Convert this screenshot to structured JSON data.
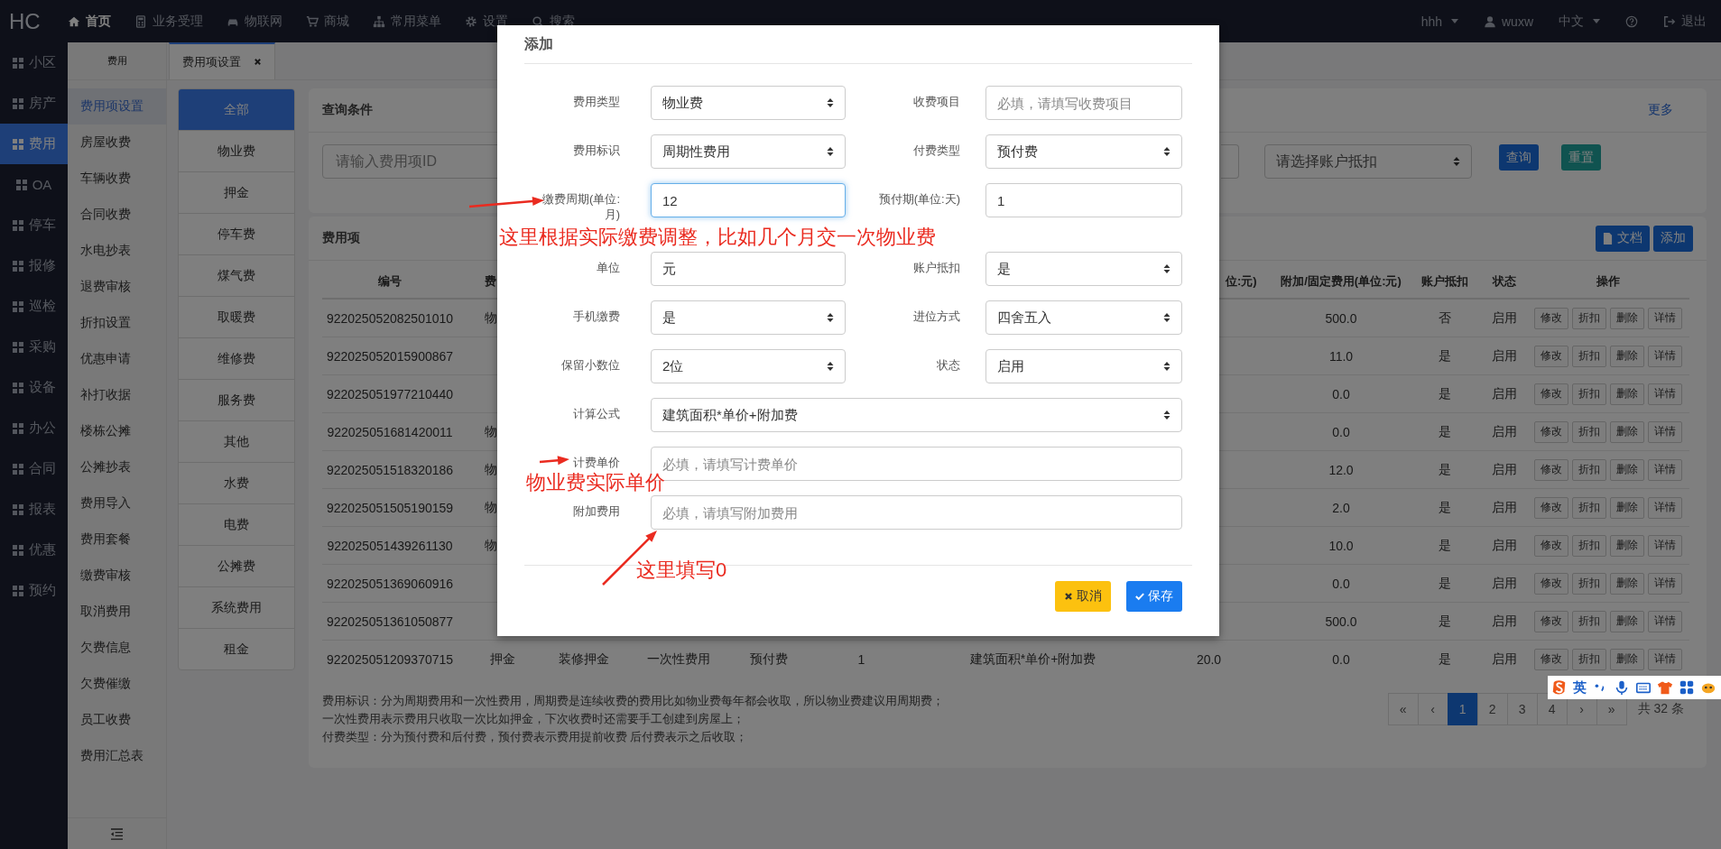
{
  "nav": {
    "logo": "HC",
    "items": [
      {
        "label": "首页",
        "selected": true
      },
      {
        "label": "业务受理",
        "selected": false
      },
      {
        "label": "物联网",
        "selected": false
      },
      {
        "label": "商城",
        "selected": false
      },
      {
        "label": "常用菜单",
        "selected": false
      },
      {
        "label": "设置",
        "selected": false
      },
      {
        "label": "搜索",
        "selected": false
      }
    ],
    "right": [
      {
        "kind": "menu",
        "label": "hhh"
      },
      {
        "kind": "user",
        "label": "wuxw"
      },
      {
        "kind": "menu",
        "label": "中文"
      },
      {
        "kind": "help"
      },
      {
        "kind": "logout",
        "label": "退出"
      }
    ]
  },
  "modules": [
    {
      "label": "小区",
      "selected": false
    },
    {
      "label": "房产",
      "selected": false
    },
    {
      "label": "费用",
      "selected": true
    },
    {
      "label": "OA",
      "selected": false
    },
    {
      "label": "停车",
      "selected": false
    },
    {
      "label": "报修",
      "selected": false
    },
    {
      "label": "巡检",
      "selected": false
    },
    {
      "label": "采购",
      "selected": false
    },
    {
      "label": "设备",
      "selected": false
    },
    {
      "label": "办公",
      "selected": false
    },
    {
      "label": "合同",
      "selected": false
    },
    {
      "label": "报表",
      "selected": false
    },
    {
      "label": "优惠",
      "selected": false
    },
    {
      "label": "预约",
      "selected": false
    }
  ],
  "submenu": {
    "title": "费用",
    "items": [
      {
        "label": "费用项设置",
        "selected": true
      },
      {
        "label": "房屋收费",
        "selected": false
      },
      {
        "label": "车辆收费",
        "selected": false
      },
      {
        "label": "合同收费",
        "selected": false
      },
      {
        "label": "水电抄表",
        "selected": false
      },
      {
        "label": "退费审核",
        "selected": false
      },
      {
        "label": "折扣设置",
        "selected": false
      },
      {
        "label": "优惠申请",
        "selected": false
      },
      {
        "label": "补打收据",
        "selected": false
      },
      {
        "label": "楼栋公摊",
        "selected": false
      },
      {
        "label": "公摊抄表",
        "selected": false
      },
      {
        "label": "费用导入",
        "selected": false
      },
      {
        "label": "费用套餐",
        "selected": false
      },
      {
        "label": "缴费审核",
        "selected": false
      },
      {
        "label": "取消费用",
        "selected": false
      },
      {
        "label": "欠费信息",
        "selected": false
      },
      {
        "label": "欠费催缴",
        "selected": false
      },
      {
        "label": "员工收费",
        "selected": false
      },
      {
        "label": "费用汇总表",
        "selected": false
      }
    ]
  },
  "tabs": [
    {
      "label": "费用项设置",
      "selected": true
    }
  ],
  "fee_types": [
    {
      "label": "全部",
      "selected": true
    },
    {
      "label": "物业费",
      "selected": false
    },
    {
      "label": "押金",
      "selected": false
    },
    {
      "label": "停车费",
      "selected": false
    },
    {
      "label": "煤气费",
      "selected": false
    },
    {
      "label": "取暖费",
      "selected": false
    },
    {
      "label": "维修费",
      "selected": false
    },
    {
      "label": "服务费",
      "selected": false
    },
    {
      "label": "其他",
      "selected": false
    },
    {
      "label": "水费",
      "selected": false
    },
    {
      "label": "电费",
      "selected": false
    },
    {
      "label": "公摊费",
      "selected": false
    },
    {
      "label": "系统费用",
      "selected": false
    },
    {
      "label": "租金",
      "selected": false
    }
  ],
  "query": {
    "title": "查询条件",
    "more": "更多",
    "id_placeholder": "请输入费用项ID",
    "deduct_placeholder": "请选择账户抵扣",
    "buttons": [
      {
        "kind": "search",
        "label": "查询"
      },
      {
        "kind": "reset",
        "label": "重置"
      }
    ]
  },
  "table": {
    "title": "费用项",
    "buttons": [
      {
        "kind": "doc",
        "label": "文档"
      },
      {
        "kind": "add",
        "label": "添加"
      }
    ],
    "header": {
      "id": "编号",
      "column_2": "费",
      "column_8": "位:元)",
      "extra_fee": "附加/固定费用(单位:元)",
      "account_deduct": "账户抵扣",
      "status": "状态",
      "actions": "操作"
    },
    "rows": [
      {
        "id": "922025052082501010",
        "column_2": "物",
        "extra_fee": "500.0",
        "account_deduct": "否",
        "status": "启用",
        "actions": [
          "修改",
          "折扣",
          "删除",
          "详情"
        ]
      },
      {
        "id": "922025052015900867",
        "extra_fee": "11.0",
        "account_deduct": "是",
        "status": "启用",
        "actions": [
          "修改",
          "折扣",
          "删除",
          "详情"
        ]
      },
      {
        "id": "922025051977210440",
        "extra_fee": "0.0",
        "account_deduct": "是",
        "status": "启用",
        "actions": [
          "修改",
          "折扣",
          "删除",
          "详情"
        ]
      },
      {
        "id": "922025051681420011",
        "column_2": "物",
        "extra_fee": "0.0",
        "account_deduct": "是",
        "status": "启用",
        "actions": [
          "修改",
          "折扣",
          "删除",
          "详情"
        ]
      },
      {
        "id": "922025051518320186",
        "column_2": "物",
        "extra_fee": "12.0",
        "account_deduct": "是",
        "status": "启用",
        "actions": [
          "修改",
          "折扣",
          "删除",
          "详情"
        ]
      },
      {
        "id": "922025051505190159",
        "column_2": "物",
        "extra_fee": "2.0",
        "account_deduct": "是",
        "status": "启用",
        "actions": [
          "修改",
          "折扣",
          "删除",
          "详情"
        ]
      },
      {
        "id": "922025051439261130",
        "column_2": "物",
        "extra_fee": "10.0",
        "account_deduct": "是",
        "status": "启用",
        "actions": [
          "修改",
          "折扣",
          "删除",
          "详情"
        ]
      },
      {
        "id": "922025051369060916",
        "extra_fee": "0.0",
        "account_deduct": "是",
        "status": "启用",
        "actions": [
          "修改",
          "折扣",
          "删除",
          "详情"
        ]
      },
      {
        "id": "922025051361050877",
        "extra_fee": "500.0",
        "account_deduct": "是",
        "status": "启用",
        "actions": [
          "修改",
          "折扣",
          "删除",
          "详情"
        ]
      },
      {
        "id": "922025051209370715",
        "column_2": "押金",
        "column_3": "装修押金",
        "column_4": "一次性费用",
        "column_5": "预付费",
        "column_6": "1",
        "column_7": "建筑面积*单价+附加费",
        "column_8": "20.0",
        "extra_fee": "0.0",
        "account_deduct": "是",
        "status": "启用",
        "actions": [
          "修改",
          "折扣",
          "删除",
          "详情"
        ]
      }
    ]
  },
  "notes": [
    "费用标识：分为周期费用和一次性费用，周期费是连续收费的费用比如物业费每年都会收取，所以物业费建议用周期费；",
    "一次性费用表示费用只收取一次比如押金，下次收费时还需要手工创建到房屋上；",
    "付费类型：分为预付费和后付费，预付费表示费用提前收费 后付费表示之后收取；"
  ],
  "pagination": {
    "first": "«",
    "prev": "‹",
    "pages": [
      {
        "label": "1",
        "selected": true
      },
      {
        "label": "2",
        "selected": false
      },
      {
        "label": "3",
        "selected": false
      },
      {
        "label": "4",
        "selected": false
      }
    ],
    "next": "›",
    "last": "»",
    "total": "共 32 条"
  },
  "ime_bar": {
    "mode": "英"
  },
  "modal": {
    "title": "添加",
    "fields": [
      {
        "label": "费用类型",
        "kind": "select",
        "value": "物业费",
        "focused": false
      },
      {
        "label": "收费项目",
        "kind": "input",
        "placeholder": "必填，请填写收费项目",
        "focused": false
      },
      {
        "label": "费用标识",
        "kind": "select",
        "value": "周期性费用",
        "focused": false
      },
      {
        "label": "付费类型",
        "kind": "select",
        "value": "预付费",
        "focused": false
      },
      {
        "label": "缴费周期(单位:月)",
        "kind": "input",
        "value": "12",
        "focused": true
      },
      {
        "label": "预付期(单位:天)",
        "kind": "input",
        "value": "1",
        "focused": false
      },
      {
        "label": "单位",
        "kind": "input",
        "value": "元",
        "focused": false
      },
      {
        "label": "账户抵扣",
        "kind": "select",
        "value": "是",
        "focused": false
      },
      {
        "label": "手机缴费",
        "kind": "select",
        "value": "是",
        "focused": false
      },
      {
        "label": "进位方式",
        "kind": "select",
        "value": "四舍五入",
        "focused": false
      },
      {
        "label": "保留小数位",
        "kind": "select",
        "value": "2位",
        "focused": false
      },
      {
        "label": "状态",
        "kind": "select",
        "value": "启用",
        "focused": false
      },
      {
        "label": "计算公式",
        "kind": "wide_select",
        "value": "建筑面积*单价+附加费",
        "focused": false
      },
      {
        "label": "计费单价",
        "kind": "wide_input",
        "placeholder": "必填，请填写计费单价",
        "focused": false
      },
      {
        "label": "附加费用",
        "kind": "wide_input",
        "placeholder": "必填，请填写附加费用",
        "focused": false
      }
    ],
    "buttons": [
      {
        "kind": "cancel",
        "label": "取消"
      },
      {
        "kind": "save",
        "label": "保存"
      }
    ]
  },
  "annotations": [
    {
      "text": "这里根据实际缴费调整，比如几个月交一次物业费"
    },
    {
      "text": "物业费实际单价"
    },
    {
      "text": "这里填写0"
    }
  ]
}
